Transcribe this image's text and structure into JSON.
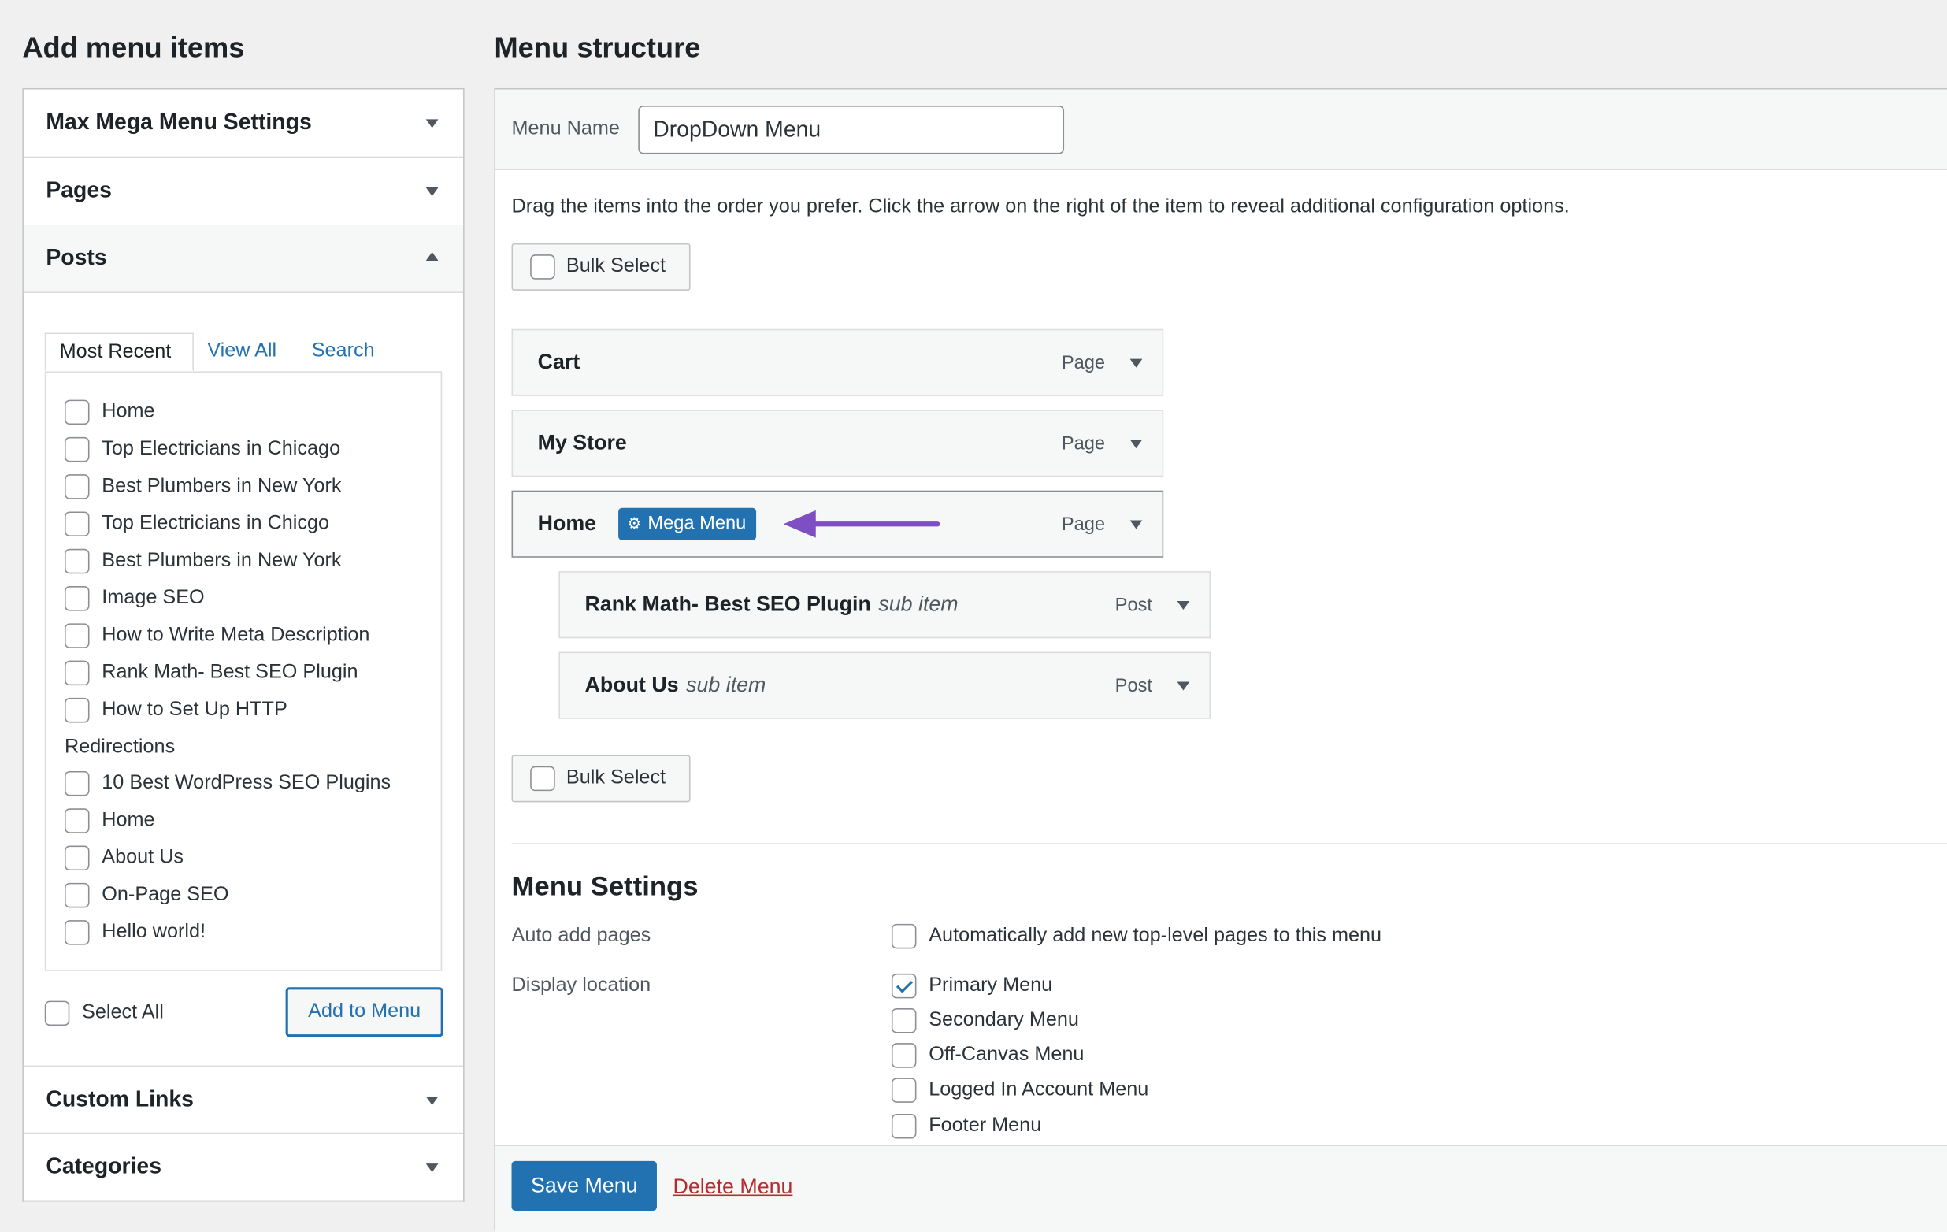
{
  "left": {
    "title": "Add menu items",
    "sections": {
      "max_mega_menu": "Max Mega Menu Settings",
      "pages": "Pages",
      "posts": "Posts",
      "custom_links": "Custom Links",
      "categories": "Categories"
    },
    "tabs": {
      "most_recent": "Most Recent",
      "view_all": "View All",
      "search": "Search"
    },
    "posts": [
      "Home",
      "Top Electricians in Chicago",
      "Best Plumbers in New York",
      "Top Electricians in Chicgo",
      "Best Plumbers in New York",
      "Image SEO",
      "How to Write Meta Description",
      "Rank Math- Best SEO Plugin",
      "How to Set Up HTTP",
      "Redirections",
      "10 Best WordPress SEO Plugins",
      "Home",
      "About Us",
      "On-Page SEO",
      "Hello world!"
    ],
    "select_all": "Select All",
    "add_to_menu": "Add to Menu"
  },
  "right": {
    "title": "Menu structure",
    "menu_name_label": "Menu Name",
    "menu_name_value": "DropDown Menu",
    "instructions": "Drag the items into the order you prefer. Click the arrow on the right of the item to reveal additional configuration options.",
    "bulk_select": "Bulk Select",
    "items": [
      {
        "title": "Cart",
        "type": "Page"
      },
      {
        "title": "My Store",
        "type": "Page"
      },
      {
        "title": "Home",
        "type": "Page",
        "badge": "Mega Menu"
      },
      {
        "title": "Rank Math- Best SEO Plugin",
        "sub": "sub item",
        "type": "Post"
      },
      {
        "title": "About Us",
        "sub": "sub item",
        "type": "Post"
      }
    ],
    "settings": {
      "title": "Menu Settings",
      "auto_add_label": "Auto add pages",
      "auto_add_option": "Automatically add new top-level pages to this menu",
      "display_location_label": "Display location",
      "locations": [
        {
          "label": "Primary Menu",
          "checked": true
        },
        {
          "label": "Secondary Menu",
          "checked": false
        },
        {
          "label": "Off-Canvas Menu",
          "checked": false
        },
        {
          "label": "Logged In Account Menu",
          "checked": false
        },
        {
          "label": "Footer Menu",
          "checked": false
        }
      ]
    },
    "save_menu": "Save Menu",
    "delete_menu": "Delete Menu"
  },
  "colors": {
    "accent": "#2271b1",
    "arrow": "#7e4fc2",
    "delete": "#b32d2e"
  },
  "icons": {
    "gear": "gear-icon",
    "expand": "triangle-down-icon",
    "collapse": "triangle-up-icon",
    "pointer": "arrow-left-icon"
  }
}
